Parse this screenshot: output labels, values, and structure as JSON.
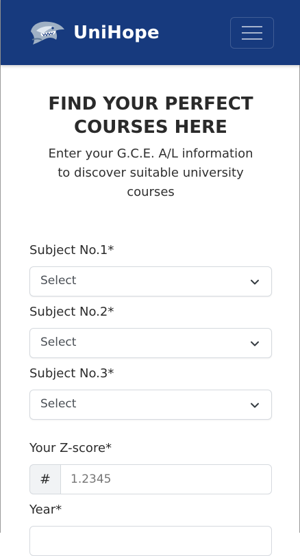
{
  "navbar": {
    "brand": "UniHope",
    "logo_icon": "shark-logo-icon",
    "menu_icon": "hamburger-menu-icon",
    "background": "#173a7e"
  },
  "hero": {
    "title_line1": "FIND YOUR PERFECT",
    "title_line2": "COURSES HERE",
    "subtitle": "Enter your G.C.E. A/L information to discover suitable university courses"
  },
  "form": {
    "subject1": {
      "label": "Subject No.1*",
      "value": "Select"
    },
    "subject2": {
      "label": "Subject No.2*",
      "value": "Select"
    },
    "subject3": {
      "label": "Subject No.3*",
      "value": "Select"
    },
    "zscore": {
      "label": "Your Z-score*",
      "prefix": "#",
      "placeholder": "1.2345"
    },
    "year": {
      "label": "Year*"
    }
  }
}
